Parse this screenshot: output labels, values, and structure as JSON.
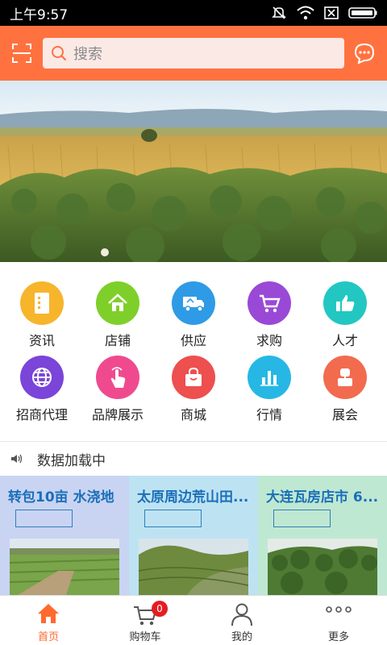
{
  "status_bar": {
    "time": "上午9:57"
  },
  "search": {
    "placeholder": "搜索"
  },
  "categories": [
    {
      "label": "资讯",
      "icon": "document-icon",
      "color": "#f7b52c"
    },
    {
      "label": "店铺",
      "icon": "home-icon",
      "color": "#7fcf2b"
    },
    {
      "label": "供应",
      "icon": "truck-icon",
      "color": "#2f9be6"
    },
    {
      "label": "求购",
      "icon": "cart-icon",
      "color": "#9a49d6"
    },
    {
      "label": "人才",
      "icon": "thumbs-up-icon",
      "color": "#22c7c2"
    },
    {
      "label": "招商代理",
      "icon": "globe-icon",
      "color": "#7a45d8"
    },
    {
      "label": "品牌展示",
      "icon": "touch-icon",
      "color": "#f04a8f"
    },
    {
      "label": "商城",
      "icon": "shopping-bag-icon",
      "color": "#ee4f4f"
    },
    {
      "label": "行情",
      "icon": "bar-chart-icon",
      "color": "#27b7e4"
    },
    {
      "label": "展会",
      "icon": "cake-icon",
      "color": "#f26b4f"
    }
  ],
  "notice": {
    "text": "数据加载中"
  },
  "cards": [
    {
      "title": "转包10亩 水浇地",
      "bg": "#c9d4f3"
    },
    {
      "title": "太原周边荒山田...",
      "bg": "#bde3f3"
    },
    {
      "title": "大连瓦房店市 6...",
      "bg": "#bfe8d2"
    }
  ],
  "tabs": [
    {
      "label": "首页",
      "icon": "home-icon",
      "active": true
    },
    {
      "label": "购物车",
      "icon": "cart-icon",
      "badge": "0"
    },
    {
      "label": "我的",
      "icon": "user-icon"
    },
    {
      "label": "更多",
      "icon": "more-icon"
    }
  ],
  "colors": {
    "accent": "#ff7240",
    "tab_active": "#ff6a2e"
  }
}
